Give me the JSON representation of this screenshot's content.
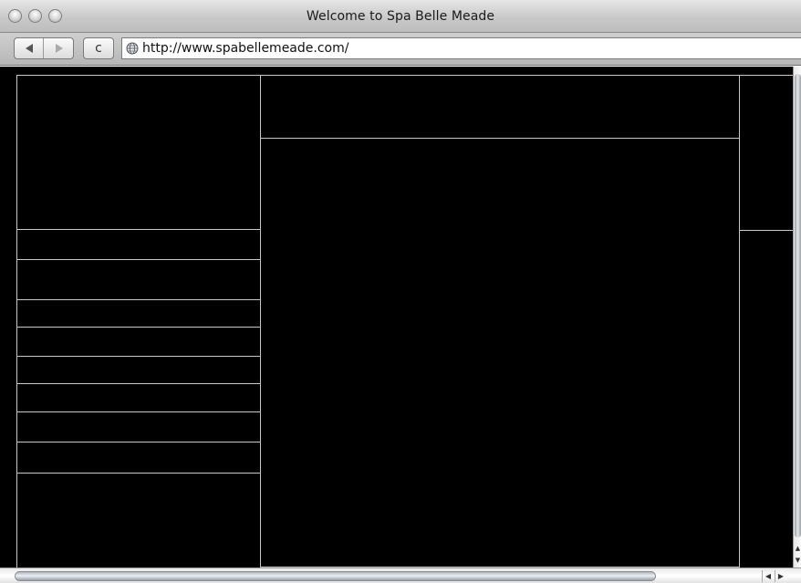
{
  "window": {
    "title": "Welcome to Spa Belle Meade"
  },
  "toolbar": {
    "url": "http://www.spabellemeade.com/",
    "reload_glyph": "c",
    "icons": [
      "back-arrow-icon",
      "forward-arrow-icon",
      "reload-icon",
      "globe-icon"
    ]
  },
  "page": {
    "background": "#000000",
    "frame_border_color": "#c8c8c8",
    "note": ""
  },
  "colors": {
    "chrome_light": "#e6e6e6",
    "chrome_dark": "#bdbdbd"
  }
}
